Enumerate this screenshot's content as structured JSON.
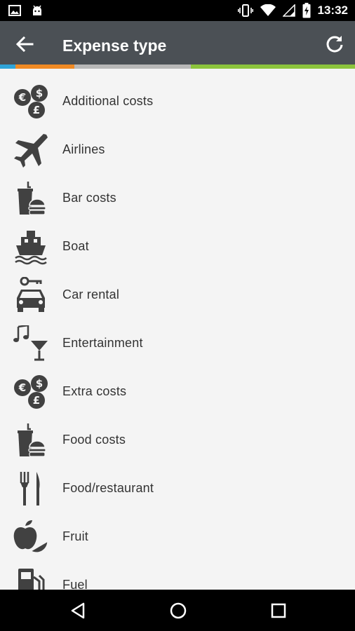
{
  "status_bar": {
    "time": "13:32",
    "icons": [
      "image-icon",
      "android-icon",
      "vibrate-icon",
      "wifi-icon",
      "signal-icon",
      "battery-charging-icon"
    ]
  },
  "app_bar": {
    "title": "Expense type",
    "back_icon": "arrow-back-icon",
    "refresh_icon": "refresh-icon",
    "color": "#4b5055"
  },
  "accent_stripe": [
    "#2fa4d8",
    "#f08a24",
    "#b8b8b8",
    "#8cc43c"
  ],
  "expense_types": [
    {
      "label": "Additional costs",
      "icon": "currency-coins-icon"
    },
    {
      "label": "Airlines",
      "icon": "airplane-icon"
    },
    {
      "label": "Bar costs",
      "icon": "drink-burger-icon"
    },
    {
      "label": "Boat",
      "icon": "boat-icon"
    },
    {
      "label": "Car rental",
      "icon": "car-key-icon"
    },
    {
      "label": "Entertainment",
      "icon": "music-cocktail-icon"
    },
    {
      "label": "Extra costs",
      "icon": "currency-coins-icon"
    },
    {
      "label": "Food costs",
      "icon": "drink-burger-icon"
    },
    {
      "label": "Food/restaurant",
      "icon": "fork-knife-icon"
    },
    {
      "label": "Fruit",
      "icon": "fruit-icon"
    },
    {
      "label": "Fuel",
      "icon": "fuel-pump-icon"
    }
  ],
  "nav_bar": {
    "icons": [
      "nav-back-icon",
      "nav-home-icon",
      "nav-recents-icon"
    ]
  }
}
